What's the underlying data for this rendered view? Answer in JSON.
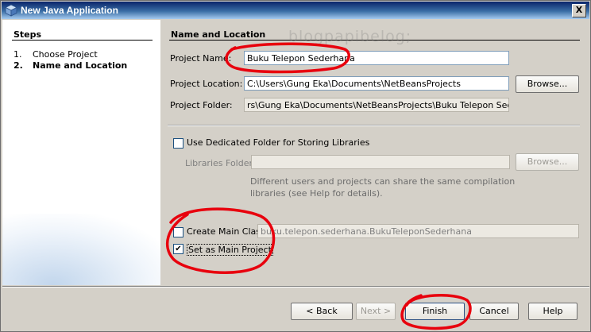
{
  "window": {
    "title": "New Java Application",
    "close_label": "X"
  },
  "watermark": "blogpapibelog;",
  "steps": {
    "title": "Steps",
    "items": [
      {
        "num": "1.",
        "label": "Choose Project"
      },
      {
        "num": "2.",
        "label": "Name and Location"
      }
    ]
  },
  "form": {
    "section_title": "Name and Location",
    "project_name_label": "Project Name:",
    "project_name_value": "Buku Telepon Sederhana",
    "project_location_label": "Project Location:",
    "project_location_value": "C:\\Users\\Gung Eka\\Documents\\NetBeansProjects",
    "browse_label": "Browse...",
    "project_folder_label": "Project Folder:",
    "project_folder_value": "rs\\Gung Eka\\Documents\\NetBeansProjects\\Buku Telepon Sederhana",
    "dedicated_folder_label": "Use Dedicated Folder for Storing Libraries",
    "libraries_folder_label": "Libraries Folder:",
    "libraries_folder_value": "",
    "libraries_browse_label": "Browse...",
    "help_text": "Different users and projects can share the same compilation libraries (see Help for details).",
    "create_main_class_label": "Create Main Class",
    "main_class_value": "buku.telepon.sederhana.BukuTeleponSederhana",
    "set_main_project_label": "Set as Main Project",
    "set_main_project_check": "✔"
  },
  "buttons": {
    "back": "< Back",
    "next": "Next >",
    "finish": "Finish",
    "cancel": "Cancel",
    "help": "Help"
  },
  "annotation_color": "#e8000d"
}
